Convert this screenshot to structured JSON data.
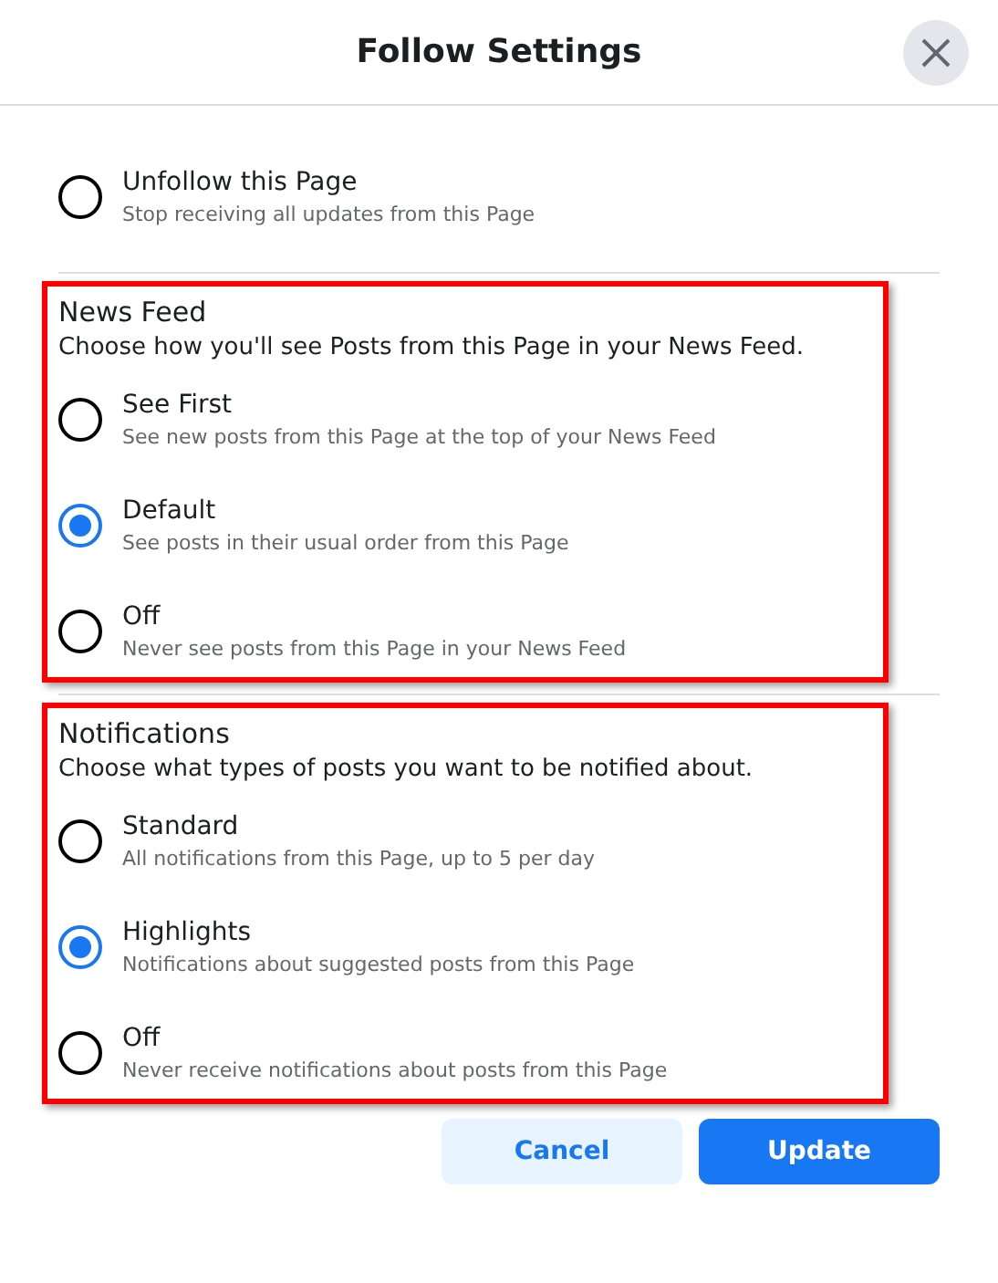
{
  "dialog": {
    "title": "Follow Settings"
  },
  "unfollow": {
    "label": "Unfollow this Page",
    "description": "Stop receiving all updates from this Page",
    "selected": false
  },
  "sections": [
    {
      "heading": "News Feed",
      "description": "Choose how you'll see Posts from this Page in your News Feed.",
      "highlighted": true,
      "options": [
        {
          "label": "See First",
          "description": "See new posts from this Page at the top of your News Feed",
          "selected": false
        },
        {
          "label": "Default",
          "description": "See posts in their usual order from this Page",
          "selected": true
        },
        {
          "label": "Off",
          "description": "Never see posts from this Page in your News Feed",
          "selected": false
        }
      ]
    },
    {
      "heading": "Notifications",
      "description": "Choose what types of posts you want to be notified about.",
      "highlighted": true,
      "options": [
        {
          "label": "Standard",
          "description": "All notifications from this Page, up to 5 per day",
          "selected": false
        },
        {
          "label": "Highlights",
          "description": "Notifications about suggested posts from this Page",
          "selected": true
        },
        {
          "label": "Off",
          "description": "Never receive notifications about posts from this Page",
          "selected": false
        }
      ]
    }
  ],
  "buttons": [
    {
      "label": "Cancel",
      "kind": "secondary"
    },
    {
      "label": "Update",
      "kind": "primary"
    }
  ]
}
